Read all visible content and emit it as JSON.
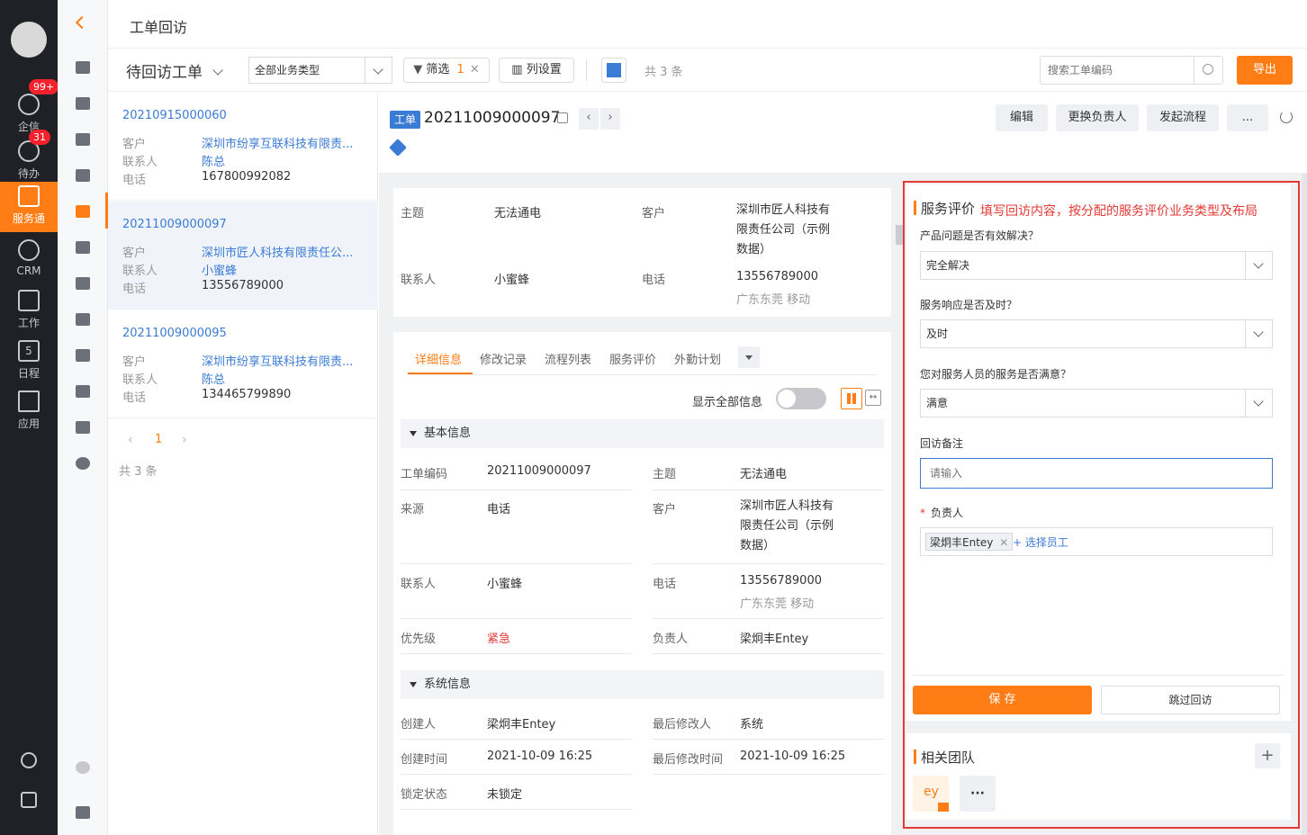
{
  "nav": {
    "items": [
      {
        "label": "企信",
        "badge": "99+"
      },
      {
        "label": "待办",
        "badge": "31"
      },
      {
        "label": "服务通"
      },
      {
        "label": "CRM"
      },
      {
        "label": "工作"
      },
      {
        "label": "日程",
        "day": "5"
      },
      {
        "label": "应用"
      }
    ]
  },
  "header": {
    "title": "工单回访"
  },
  "toolbar": {
    "view_title": "待回访工单",
    "biz_type": "全部业务类型",
    "filter_label": "筛选",
    "filter_count": "1",
    "columns_label": "列设置",
    "total": "共 3 条",
    "search_placeholder": "搜索工单编码",
    "export_label": "导出"
  },
  "list": {
    "label_customer": "客户",
    "label_contact": "联系人",
    "label_phone": "电话",
    "items": [
      {
        "no": "20210915000060",
        "customer": "深圳市纷享互联科技有限责...",
        "contact": "陈总",
        "phone": "167800992082"
      },
      {
        "no": "20211009000097",
        "customer": "深圳市匠人科技有限责任公...",
        "contact": "小蜜蜂",
        "phone": "13556789000"
      },
      {
        "no": "20211009000095",
        "customer": "深圳市纷享互联科技有限责...",
        "contact": "陈总",
        "phone": "134465799890"
      }
    ],
    "page": "1",
    "total": "共 3 条"
  },
  "detail": {
    "tag": "工单",
    "no": "20211009000097",
    "actions": {
      "edit": "编辑",
      "change_owner": "更换负责人",
      "start_flow": "发起流程",
      "more": "..."
    },
    "summary": {
      "subject_label": "主题",
      "subject": "无法通电",
      "customer_label": "客户",
      "customer": "深圳市匠人科技有限责任公司（示例数据）",
      "customer_l1": "深圳市匠人科技有",
      "customer_l2": "限责任公司（示例",
      "customer_l3": "数据）",
      "contact_label": "联系人",
      "contact": "小蜜蜂",
      "phone_label": "电话",
      "phone": "13556789000",
      "phone_loc": "广东东莞 移动"
    },
    "tabs": [
      "详细信息",
      "修改记录",
      "流程列表",
      "服务评价",
      "外勤计划"
    ],
    "show_all_label": "显示全部信息",
    "basic": {
      "title": "基本信息",
      "no_label": "工单编码",
      "no": "20211009000097",
      "subject_label": "主题",
      "subject": "无法通电",
      "source_label": "来源",
      "source": "电话",
      "customer_label": "客户",
      "contact_label": "联系人",
      "contact": "小蜜蜂",
      "phone_label": "电话",
      "phone": "13556789000",
      "phone_loc": "广东东莞 移动",
      "priority_label": "优先级",
      "priority": "紧急",
      "owner_label": "负责人",
      "owner": "梁炯丰Entey"
    },
    "system": {
      "title": "系统信息",
      "creator_label": "创建人",
      "creator": "梁炯丰Entey",
      "modifier_label": "最后修改人",
      "modifier": "系统",
      "created_label": "创建时间",
      "created": "2021-10-09 16:25",
      "modified_label": "最后修改时间",
      "modified": "2021-10-09 16:25",
      "lock_label": "锁定状态",
      "lock": "未锁定"
    }
  },
  "evaluation": {
    "title": "服务评价",
    "annotation": "填写回访内容，按分配的服务评价业务类型及布局",
    "q1": "产品问题是否有效解决？",
    "a1": "完全解决",
    "q2": "服务响应是否及时？",
    "a2": "及时",
    "q3": "您对服务人员的服务是否满意？",
    "a3": "满意",
    "remark_label": "回访备注",
    "remark_placeholder": "请输入",
    "owner_label": "负责人",
    "owner_tag": "梁炯丰Entey",
    "add_staff": "+ 选择员工",
    "save": "保 存",
    "skip": "跳过回访"
  },
  "team": {
    "title": "相关团队",
    "member_initials": "ey",
    "more": "···",
    "add": "+"
  },
  "colors": {
    "accent": "#ff7d14",
    "link": "#3a7bd5",
    "danger": "#e53935"
  }
}
